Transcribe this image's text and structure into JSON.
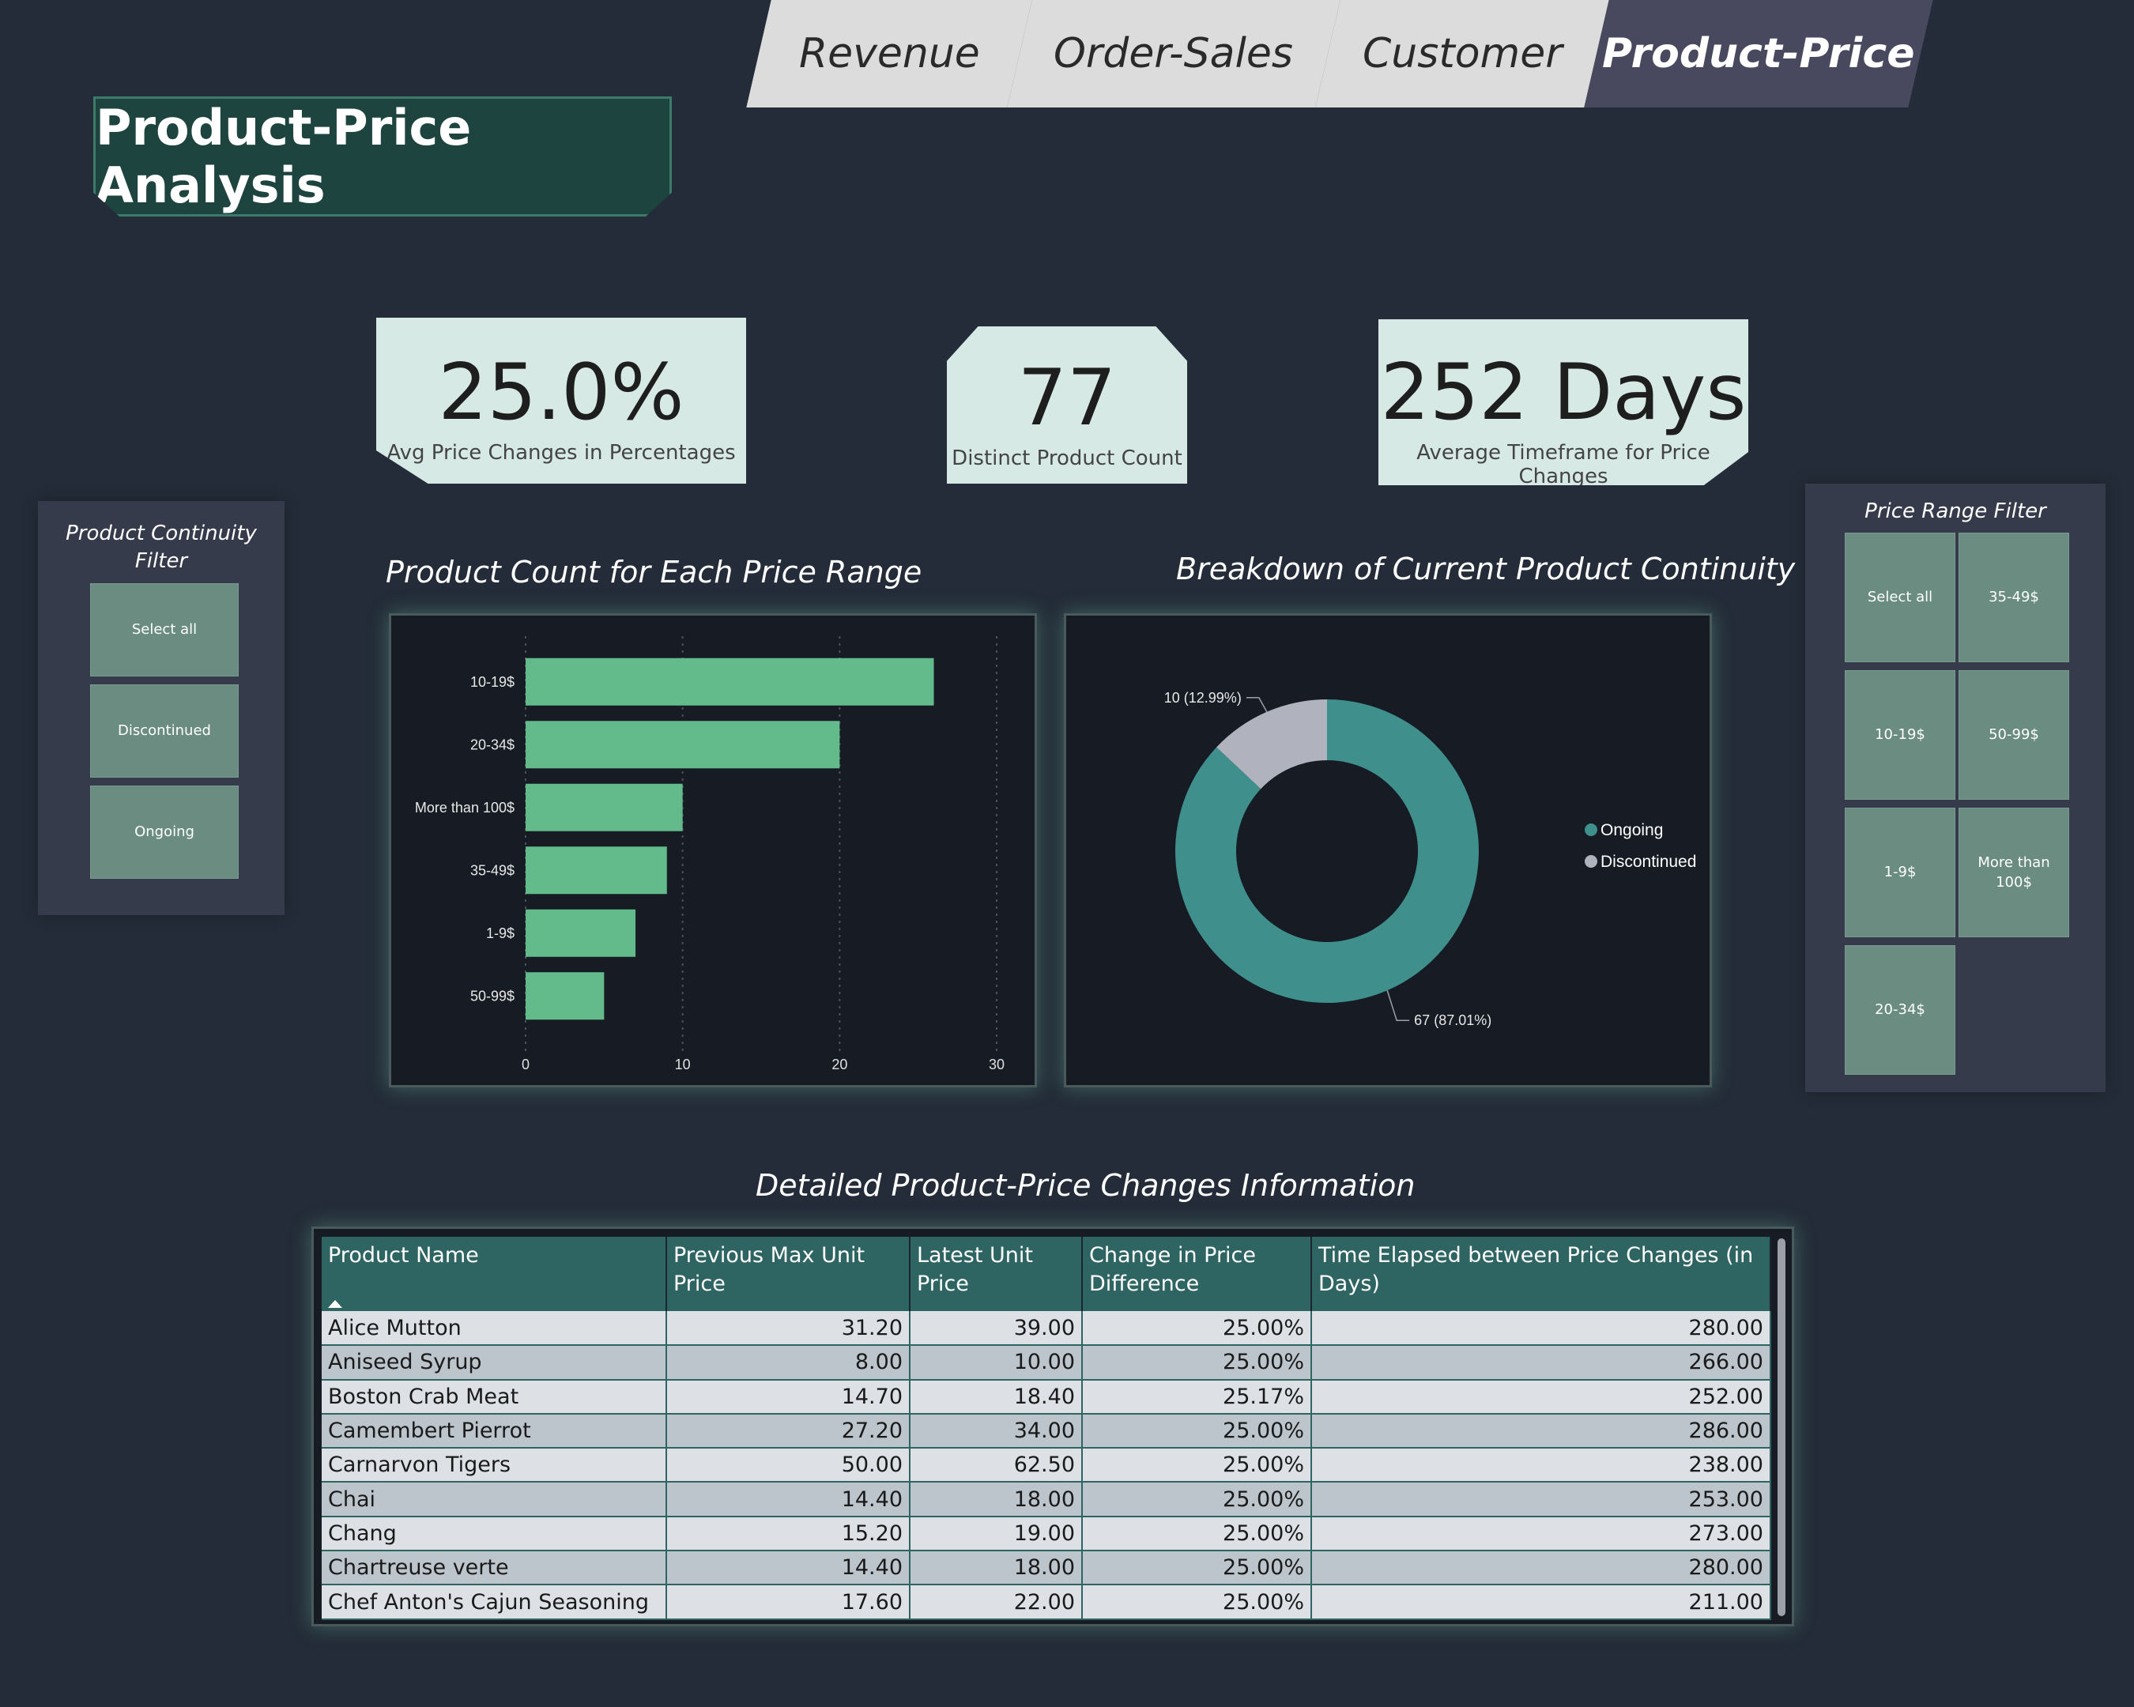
{
  "tabs": [
    {
      "label": "Revenue",
      "active": false
    },
    {
      "label": "Order-Sales",
      "active": false
    },
    {
      "label": "Customer",
      "active": false
    },
    {
      "label": "Product-Price",
      "active": true
    }
  ],
  "page_title": "Product-Price Analysis",
  "kpis": [
    {
      "value": "25.0%",
      "label": "Avg Price Changes in Percentages"
    },
    {
      "value": "77",
      "label": "Distinct Product Count"
    },
    {
      "value": "252 Days",
      "label": "Average Timeframe for Price Changes"
    }
  ],
  "continuity_filter": {
    "title_line1": "Product Continuity",
    "title_line2": "Filter",
    "options": [
      "Select all",
      "Discontinued",
      "Ongoing"
    ]
  },
  "price_filter": {
    "title": "Price Range Filter",
    "options": [
      "Select all",
      "35-49$",
      "10-19$",
      "50-99$",
      "1-9$",
      "More than 100$",
      "20-34$"
    ]
  },
  "bar_chart_title": "Product Count for Each Price Range",
  "donut_chart_title": "Breakdown of Current Product Continuity",
  "chart_data": [
    {
      "type": "bar",
      "orientation": "horizontal",
      "title": "Product Count for Each Price Range",
      "categories": [
        "10-19$",
        "20-34$",
        "More than 100$",
        "35-49$",
        "1-9$",
        "50-99$"
      ],
      "values": [
        26,
        20,
        10,
        9,
        7,
        5
      ],
      "xlim": [
        0,
        30
      ],
      "xticks": [
        0,
        10,
        20,
        30
      ],
      "grid": "vertical dotted",
      "color": "#63bb8c"
    },
    {
      "type": "pie",
      "variant": "donut",
      "title": "Breakdown of Current Product Continuity",
      "categories": [
        "Ongoing",
        "Discontinued"
      ],
      "values": [
        67,
        10
      ],
      "data_labels": [
        "67 (87.01%)",
        "10 (12.99%)"
      ],
      "colors": [
        "#3f8f8c",
        "#b0b3bd"
      ],
      "legend": "right"
    }
  ],
  "table_title": "Detailed Product-Price Changes Information",
  "table": {
    "columns": [
      "Product Name",
      "Previous Max Unit Price",
      "Latest Unit Price",
      "Change in Price Difference",
      "Time Elapsed between Price Changes (in Days)"
    ],
    "rows": [
      [
        "Alice Mutton",
        "31.20",
        "39.00",
        "25.00%",
        "280.00"
      ],
      [
        "Aniseed Syrup",
        "8.00",
        "10.00",
        "25.00%",
        "266.00"
      ],
      [
        "Boston Crab Meat",
        "14.70",
        "18.40",
        "25.17%",
        "252.00"
      ],
      [
        "Camembert Pierrot",
        "27.20",
        "34.00",
        "25.00%",
        "286.00"
      ],
      [
        "Carnarvon Tigers",
        "50.00",
        "62.50",
        "25.00%",
        "238.00"
      ],
      [
        "Chai",
        "14.40",
        "18.00",
        "25.00%",
        "253.00"
      ],
      [
        "Chang",
        "15.20",
        "19.00",
        "25.00%",
        "273.00"
      ],
      [
        "Chartreuse verte",
        "14.40",
        "18.00",
        "25.00%",
        "280.00"
      ],
      [
        "Chef Anton's Cajun Seasoning",
        "17.60",
        "22.00",
        "25.00%",
        "211.00"
      ]
    ]
  },
  "colors": {
    "background": "#232c38",
    "accent_teal": "#2e6461",
    "bar": "#63bb8c",
    "kpi_card": "#d6e9e4",
    "active_tab": "#48485e"
  }
}
